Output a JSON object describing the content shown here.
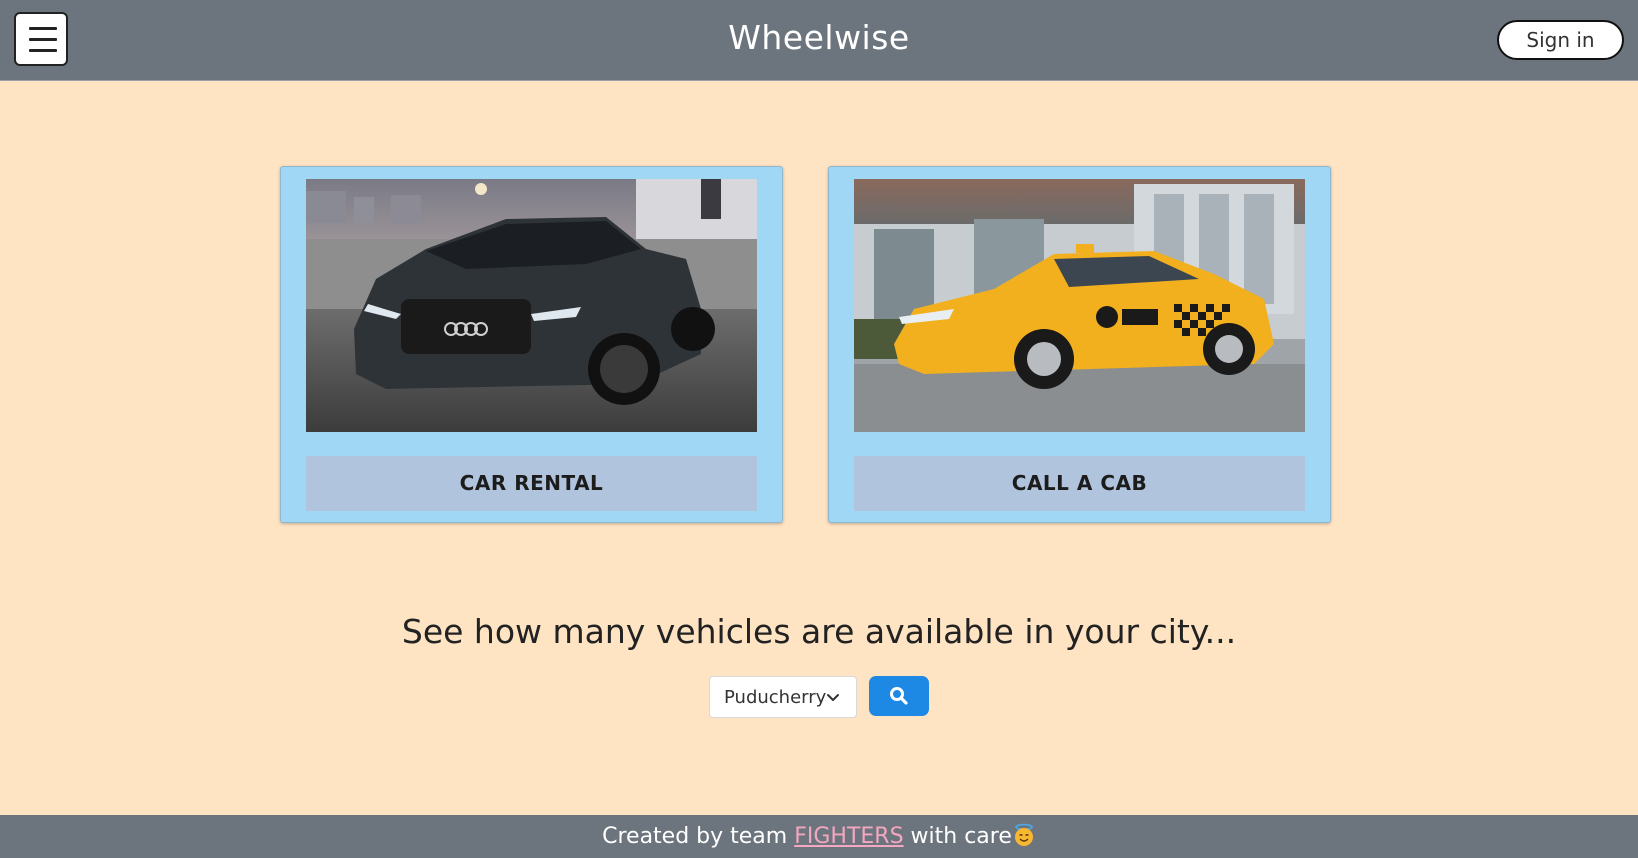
{
  "header": {
    "brand": "Wheelwise",
    "signin_label": "Sign in",
    "menu_icon": "hamburger-menu-icon"
  },
  "cards": [
    {
      "label": "CAR RENTAL",
      "image": "dark-sedan-photo"
    },
    {
      "label": "CALL A CAB",
      "image": "yellow-taxi-photo"
    }
  ],
  "availability": {
    "title": "See how many vehicles are available in your city...",
    "city_selected": "Puducherry",
    "search_icon": "search-icon"
  },
  "footer": {
    "prefix": "Created by team",
    "team": "FIGHTERS",
    "suffix": "with care",
    "emoji": "smiling-face-with-halo"
  },
  "colors": {
    "page_bg": "#ffe4c4",
    "header_bg": "#6c757d",
    "card_bg": "#a0d7f5",
    "card_button_bg": "#b0c4de",
    "search_button": "#1e88e5",
    "link": "#f4a7c0"
  }
}
